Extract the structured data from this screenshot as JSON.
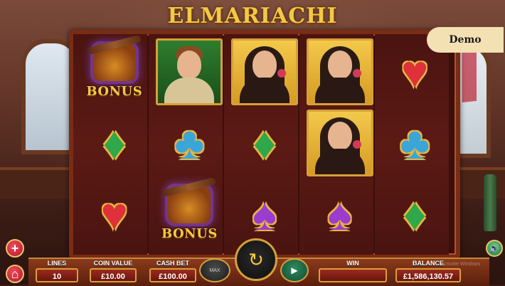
{
  "game": {
    "title": "ELMARIACHI",
    "demo_label": "Demo"
  },
  "reels": [
    [
      {
        "symbol": "bonus",
        "label": "BONUS"
      },
      {
        "symbol": "diamond",
        "icon": "diamond-icon",
        "glyph": "♦"
      },
      {
        "symbol": "heart",
        "icon": "heart-icon",
        "glyph": "♥"
      }
    ],
    [
      {
        "symbol": "mariachi-man",
        "portrait": "man"
      },
      {
        "symbol": "club",
        "icon": "club-icon",
        "glyph": "♣"
      },
      {
        "symbol": "bonus",
        "label": "BONUS"
      }
    ],
    [
      {
        "symbol": "senorita",
        "portrait": "woman"
      },
      {
        "symbol": "diamond",
        "icon": "diamond-icon",
        "glyph": "♦"
      },
      {
        "symbol": "spade",
        "icon": "spade-icon",
        "glyph": "♠"
      }
    ],
    [
      {
        "symbol": "senorita",
        "portrait": "woman"
      },
      {
        "symbol": "senorita",
        "portrait": "woman"
      },
      {
        "symbol": "spade",
        "icon": "spade-icon",
        "glyph": "♠"
      }
    ],
    [
      {
        "symbol": "heart",
        "icon": "heart-icon",
        "glyph": "♥"
      },
      {
        "symbol": "club",
        "icon": "club-icon",
        "glyph": "♣"
      },
      {
        "symbol": "diamond",
        "icon": "diamond-icon",
        "glyph": "♦"
      }
    ]
  ],
  "controls": {
    "lines_label": "LINES",
    "lines_value": "10",
    "coin_value_label": "COIN VALUE",
    "coin_value": "£10.00",
    "cash_bet_label": "CASH BET",
    "cash_bet": "£100.00",
    "win_label": "WIN",
    "win_value": "",
    "balance_label": "BALANCE",
    "balance_value": "£1,586,130.57",
    "max_label": "MAX",
    "spin_glyph": "↻",
    "auto_glyph": "▶",
    "plus_glyph": "+",
    "home_glyph": "⌂",
    "sound_glyph": "🔊"
  },
  "overlay": {
    "watermark": "Activate Windows"
  }
}
